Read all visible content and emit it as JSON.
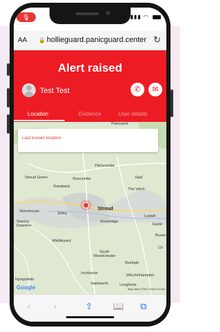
{
  "browser": {
    "text_size_label": "AA",
    "url": "hollieguard.panicguard.center"
  },
  "header": {
    "title": "Alert raised",
    "user_name": "Test Test",
    "tabs": [
      {
        "label": "Location",
        "active": true
      },
      {
        "label": "Evidence",
        "active": false
      },
      {
        "label": "User details",
        "active": false
      }
    ]
  },
  "map": {
    "card_label": "Last known location",
    "labels": {
      "painswick": "Painswick",
      "pitchcombe": "Pitchcombe",
      "stroud_green": "Stroud Green",
      "ruscombe": "Ruscombe",
      "slad": "Slad",
      "randwick": "Randwick",
      "the_vatch": "The Vatch",
      "stroud": "Stroud",
      "stonehouse": "Stonehouse",
      "ebley": "Ebley",
      "lypiatt": "Lypiatt",
      "stanley_downton": "Stanley Downton",
      "bowbridge": "Bowbridge",
      "easter": "Easte",
      "busse": "Busse",
      "middleyard": "Middleyard",
      "south_woodchester": "South Woodchester",
      "burleigh": "Burleigh",
      "inchbrook": "Inchbrook",
      "minchinhampton": "Minchinhampton",
      "nympsfield": "Nympsfield",
      "nailsworth": "Nailsworth",
      "longfords": "Longfords",
      "ch": "Ch"
    },
    "google_logo": "Google",
    "attribution": "Map data ©2021  Terms of Use"
  },
  "colors": {
    "brand_red": "#ed1c24",
    "page_background": "#f5e9f3"
  },
  "icons": {
    "reload": "↻",
    "lock": "🔒",
    "phone": "✆",
    "message": "✉",
    "back": "‹",
    "forward": "›",
    "share": "⇧",
    "bookmarks": "📖",
    "tabs": "⧉",
    "mic": "🎙"
  }
}
